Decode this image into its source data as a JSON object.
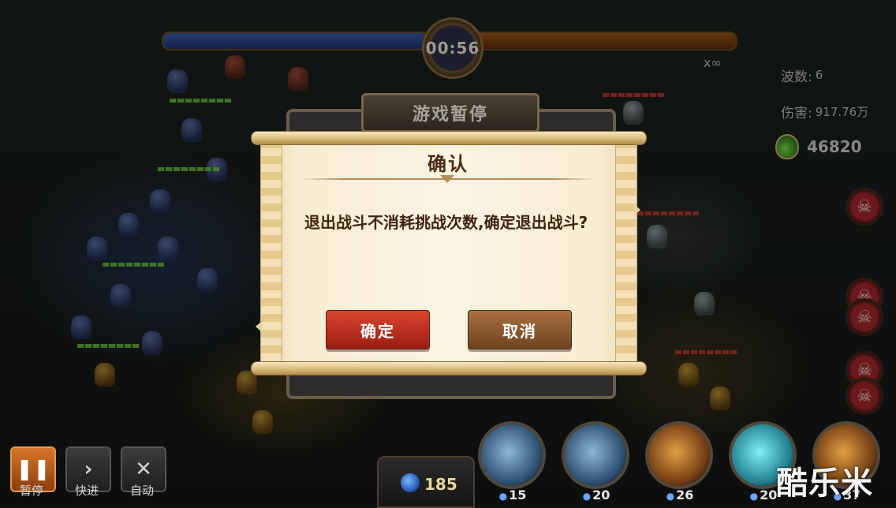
{
  "hud": {
    "timer": "00:56",
    "multiplier": "x∞",
    "wave_label": "波数:",
    "wave_value": "6",
    "damage_label": "伤害:",
    "damage_value": "917.76万",
    "gold_value": "46820",
    "mana_value": "185"
  },
  "controls": {
    "pause_label": "暂停",
    "fast_label": "快进",
    "auto_label": "自动",
    "pause_icon": "pause-icon",
    "fast_icon": "chevron-right-icon",
    "auto_icon": "crossed-swords-icon"
  },
  "skills": [
    {
      "cost": "15",
      "icon": "ice-skill-icon"
    },
    {
      "cost": "20",
      "icon": "whirlwind-skill-icon"
    },
    {
      "cost": "26",
      "icon": "warrior-skill-icon"
    },
    {
      "cost": "20",
      "icon": "vortex-skill-icon"
    },
    {
      "cost": "37",
      "icon": "fire-skill-icon"
    }
  ],
  "pause_panel": {
    "title": "游戏暂停"
  },
  "dialog": {
    "title": "确认",
    "message": "退出战斗不消耗挑战次数,确定退出战斗?",
    "confirm_label": "确定",
    "cancel_label": "取消"
  },
  "watermark": "酷乐米",
  "colors": {
    "confirm_button": "#c2301f",
    "cancel_button": "#8e5a2e",
    "scroll_paper": "#f8edd3",
    "dialog_text": "#3e2410"
  }
}
